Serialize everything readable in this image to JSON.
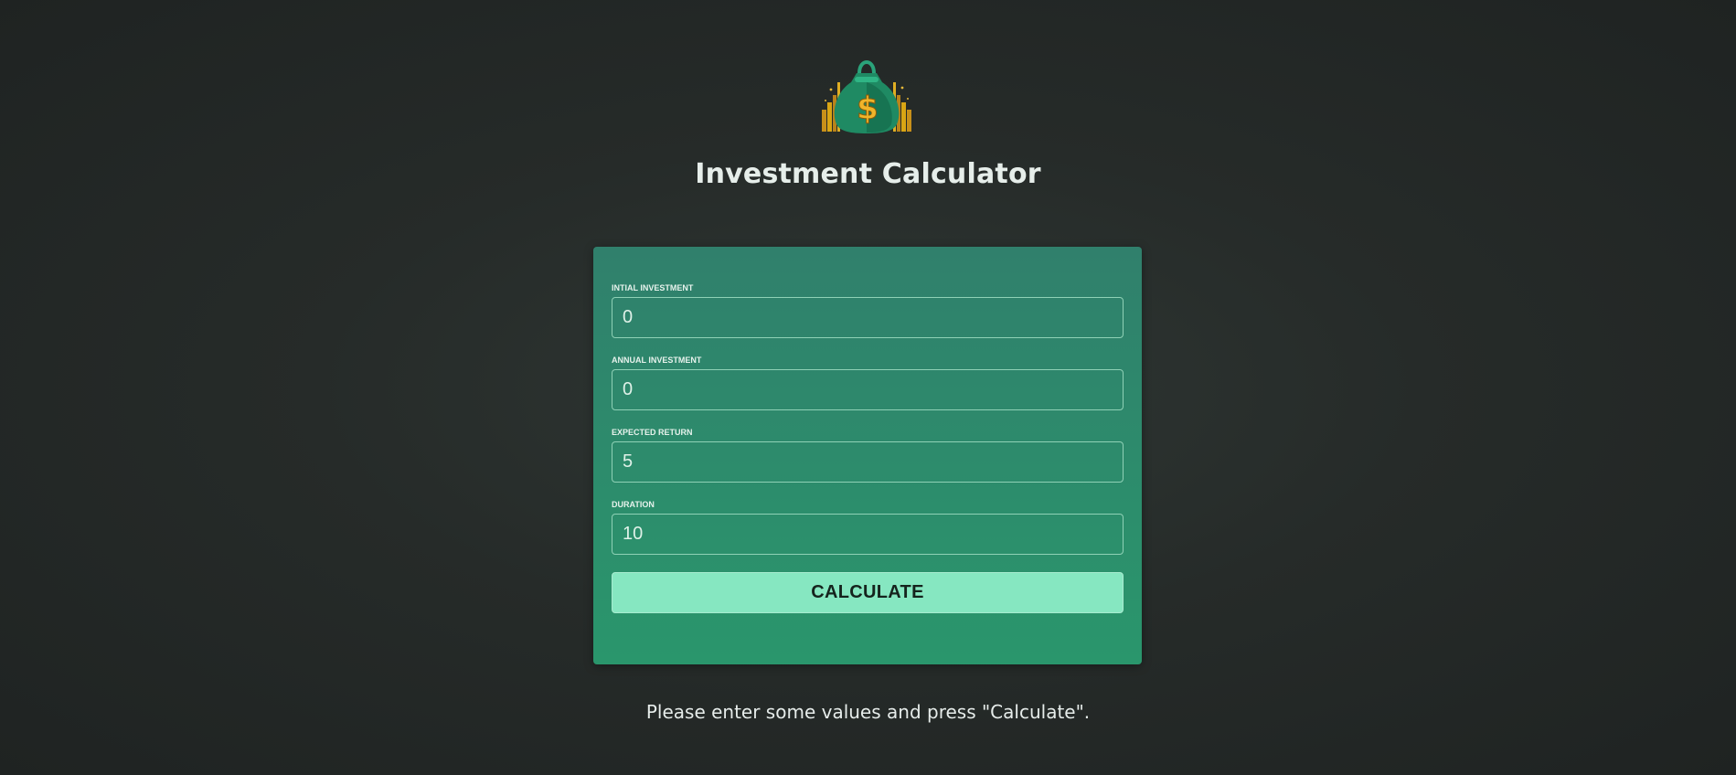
{
  "header": {
    "title": "Investment Calculator",
    "logo_icon": "money-bag-icon"
  },
  "form": {
    "fields": [
      {
        "label": "INTIAL INVESTMENT",
        "value": "0"
      },
      {
        "label": "ANNUAL INVESTMENT",
        "value": "0"
      },
      {
        "label": "EXPECTED RETURN",
        "value": "5"
      },
      {
        "label": "DURATION",
        "value": "10"
      }
    ],
    "submit_label": "CALCULATE"
  },
  "status": {
    "message": "Please enter some values and press \"Calculate\"."
  },
  "colors": {
    "background": "#262b29",
    "card_top": "#30806c",
    "card_bottom": "#2a966c",
    "button": "#86e7c1",
    "gold": "#d9a514",
    "bag_green": "#1f8a63"
  }
}
